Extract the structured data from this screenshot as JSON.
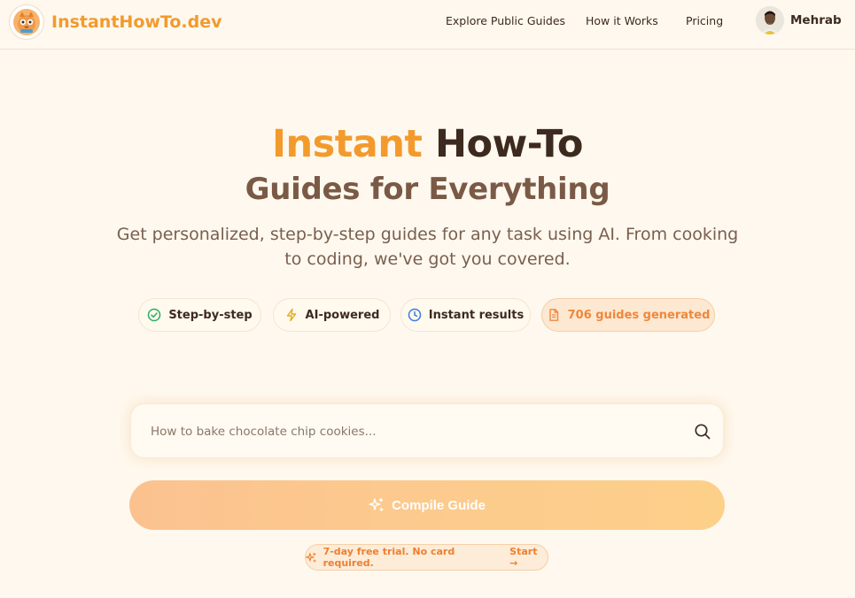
{
  "header": {
    "logo_text": "InstantHowTo.dev",
    "nav": [
      "Explore Public Guides",
      "How it Works",
      "Pricing"
    ],
    "user_name": "Mehrab"
  },
  "hero": {
    "title_accent": "Instant",
    "title_rest": "How-To",
    "title_line2": "Guides for Everything",
    "subtitle": "Get personalized, step-by-step guides for any task using AI. From cooking to coding, we've got you covered."
  },
  "features": [
    {
      "label": "Step-by-step",
      "icon": "check-circle-icon"
    },
    {
      "label": "AI-powered",
      "icon": "lightning-icon"
    },
    {
      "label": "Instant results",
      "icon": "clock-icon"
    },
    {
      "label": "706 guides generated",
      "icon": "document-icon"
    }
  ],
  "search": {
    "placeholder": "How to bake chocolate chip cookies...",
    "value": ""
  },
  "compile_button": "Compile Guide",
  "trial": {
    "text": "7-day free trial. No card required.",
    "link": "Start →"
  },
  "colors": {
    "accent": "#f39a2c",
    "background": "#fef8ee",
    "dark_text": "#3d2a1e",
    "muted_brown": "#7a5a46"
  }
}
